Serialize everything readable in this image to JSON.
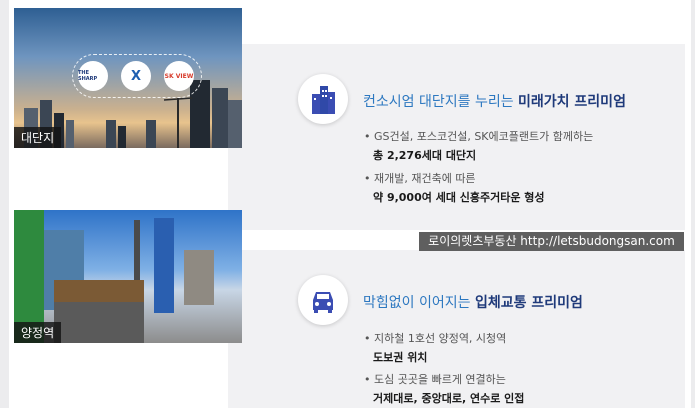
{
  "photos": {
    "city_label": "대단지",
    "station_label": "양정역"
  },
  "logos": [
    "THE SHARP",
    "X",
    "SK VIEW"
  ],
  "section1": {
    "title_plain": "컨소시엄 대단지를 누리는 ",
    "title_bold": "미래가치 프리미엄",
    "bullets": [
      {
        "text": "• GS건설, 포스코건설, SK에코플랜트가 함께하는",
        "bold": "총 2,276세대 대단지"
      },
      {
        "text": "• 재개발, 재건축에 따른",
        "bold": "약 9,000여 세대 신흥주거타운 형성"
      }
    ]
  },
  "section2": {
    "title_plain": "막힘없이 이어지는 ",
    "title_bold": "입체교통 프리미엄",
    "bullets": [
      {
        "text": "• 지하철 1호선 양정역, 시청역",
        "bold": "도보권 위치"
      },
      {
        "text": "• 도심 곳곳을 빠르게 연결하는",
        "bold": "거제대로, 중앙대로, 연수로 인접"
      }
    ]
  },
  "watermark": "로이의렛츠부동산 http://letsbudongsan.com",
  "colors": {
    "accent": "#2d78c0",
    "navy": "#1f3a7a",
    "icon": "#3b4db3"
  },
  "icons": [
    "buildings-icon",
    "car-icon"
  ]
}
